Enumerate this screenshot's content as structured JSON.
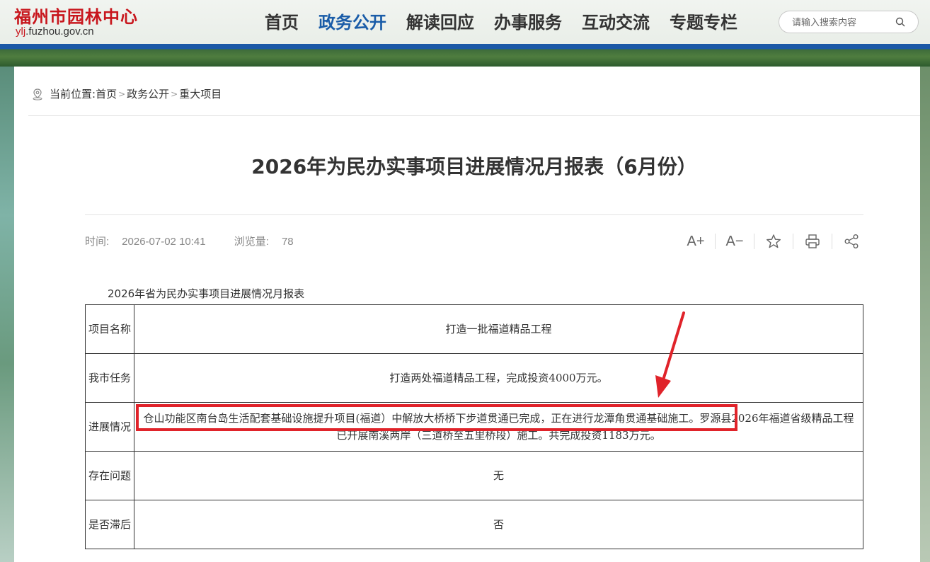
{
  "header": {
    "logo_cn": "福州市园林中心",
    "logo_url_prefix": "ylj",
    "logo_url_rest": ".fuzhou.gov.cn",
    "nav": [
      {
        "label": "首页",
        "active": false
      },
      {
        "label": "政务公开",
        "active": true
      },
      {
        "label": "解读回应",
        "active": false
      },
      {
        "label": "办事服务",
        "active": false
      },
      {
        "label": "互动交流",
        "active": false
      },
      {
        "label": "专题专栏",
        "active": false
      }
    ],
    "search_placeholder": "请输入搜索内容",
    "brand_color": "#c8161d",
    "accent_color": "#1a5ca8"
  },
  "breadcrumb": {
    "prefix": "当前位置:",
    "items": [
      "首页",
      "政务公开",
      "重大项目"
    ],
    "separator": ">"
  },
  "article": {
    "title": "2026年为民办实事项目进展情况月报表（6月份）",
    "time_label": "时间:",
    "time": "2026-07-02 10:41",
    "views_label": "浏览量:",
    "views": "78",
    "tools": {
      "font_increase": "A+",
      "font_decrease": "A−",
      "icons": [
        "font-increase-icon",
        "font-decrease-icon",
        "star-icon",
        "print-icon",
        "share-icon"
      ]
    },
    "subtitle": "2026年省为民办实事项目进展情况月报表",
    "table": [
      {
        "header": "项目名称",
        "value": "打造一批福道精品工程"
      },
      {
        "header": "我市任务",
        "value": "打造两处福道精品工程，完成投资4000万元。"
      },
      {
        "header": "进展情况",
        "value": "仓山功能区南台岛生活配套基础设施提升项目(福道）中解放大桥桥下步道贯通已完成，正在进行龙潭角贯通基础施工。罗源县2026年福道省级精品工程已开展南溪两岸（三道桥至五里桥段）施工。共完成投资1183万元。"
      },
      {
        "header": "存在问题",
        "value": "无"
      },
      {
        "header": "是否滞后",
        "value": "否"
      }
    ],
    "highlight_color": "#e0232a"
  }
}
